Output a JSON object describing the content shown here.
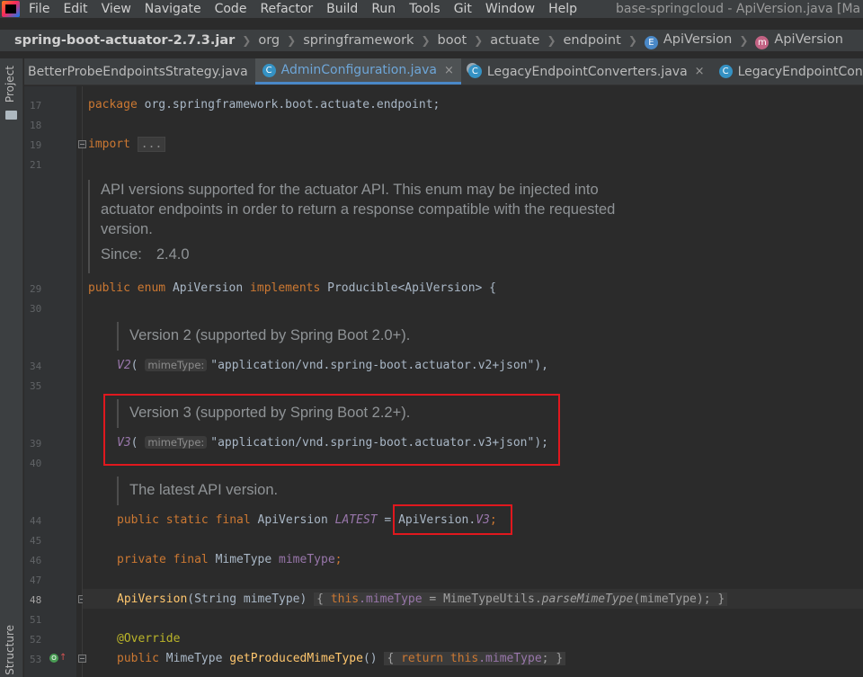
{
  "menubar": {
    "items": [
      "File",
      "Edit",
      "View",
      "Navigate",
      "Code",
      "Refactor",
      "Build",
      "Run",
      "Tools",
      "Git",
      "Window",
      "Help"
    ],
    "window_title": "base-springcloud - ApiVersion.java [Ma"
  },
  "breadcrumb": {
    "jar": "spring-boot-actuator-2.7.3.jar",
    "parts": [
      "org",
      "springframework",
      "boot",
      "actuate",
      "endpoint"
    ],
    "class_badge": "E",
    "class_name": "ApiVersion",
    "member_badge": "m",
    "member_name": "ApiVersion"
  },
  "tool_windows": {
    "left_top": "Project",
    "left_bottom": "Structure"
  },
  "tabs": [
    {
      "label": "BetterProbeEndpointsStrategy.java",
      "active": false
    },
    {
      "label": "AdminConfiguration.java",
      "active": true
    },
    {
      "label": "LegacyEndpointConverters.java",
      "active": false
    },
    {
      "label": "LegacyEndpointConve",
      "active": false
    }
  ],
  "tab_icon": "C",
  "tab_close": "×",
  "line_numbers": {
    "l17": "17",
    "l18": "18",
    "l19": "19",
    "l21": "21",
    "l29": "29",
    "l30": "30",
    "l34": "34",
    "l35": "35",
    "l39": "39",
    "l40": "40",
    "l44": "44",
    "l45": "45",
    "l46": "46",
    "l47": "47",
    "l48": "48",
    "l51": "51",
    "l52": "52",
    "l53": "53"
  },
  "code": {
    "package_kw": "package",
    "package_name": " org.springframework.boot.actuate.endpoint;",
    "import_kw": "import",
    "import_fold": "...",
    "enum_public": "public",
    "enum_enum": "enum",
    "enum_name": "ApiVersion",
    "enum_implements": "implements",
    "enum_iface": "Producible",
    "enum_generic": "<ApiVersion>",
    "enum_brace": " {",
    "v2_name": "V2",
    "v3_name": "V3",
    "paren_open": "(",
    "hint_mime": "mimeType:",
    "v2_str": "\"application/vnd.spring-boot.actuator.v2+json\"",
    "v2_tail": "),",
    "v3_str": "\"application/vnd.spring-boot.actuator.v3+json\"",
    "v3_tail": ");",
    "latest_mods": "public static final",
    "latest_type": " ApiVersion ",
    "latest_name": "LATEST",
    "latest_eq": " = ",
    "latest_value_cls": "ApiVersion.",
    "latest_value_fld": "V3",
    "latest_semi": ";",
    "field_mods": "private final",
    "field_type": " MimeType ",
    "field_name": "mimeType",
    "field_semi": ";",
    "ctor_name": "ApiVersion",
    "ctor_params": "(String mimeType) ",
    "ctor_body_open": "{ ",
    "ctor_this": "this",
    "ctor_dot_field": ".mimeType",
    "ctor_assign": " = MimeTypeUtils.",
    "ctor_call": "parseMimeType",
    "ctor_args": "(mimeType)",
    "ctor_body_close": "; }",
    "override": "@Override",
    "getter_public": "public",
    "getter_type": " MimeType ",
    "getter_name": "getProducedMimeType",
    "getter_parens": "() ",
    "getter_open": "{ ",
    "getter_return": "return",
    "getter_this": " this",
    "getter_field": ".mimeType",
    "getter_close": "; }"
  },
  "docs": {
    "enum_doc_1": "API versions supported for the actuator API. This enum may be injected into",
    "enum_doc_2": "actuator endpoints in order to return a response compatible with the requested",
    "enum_doc_3": "version.",
    "since_label": "Since:",
    "since_value": "2.4.0",
    "v2_doc": "Version 2 (supported by Spring Boot 2.0+).",
    "v3_doc": "Version 3 (supported by Spring Boot 2.2+).",
    "latest_doc": "The latest API version."
  },
  "gutter_icons": {
    "override_badge": "O",
    "override_arrow": "↑"
  },
  "colors": {
    "keyword": "#cc7832",
    "string": "#6a8759",
    "field": "#9876aa",
    "annotation_box": "#e0181e",
    "active_tab_text": "#6ea6d8"
  }
}
